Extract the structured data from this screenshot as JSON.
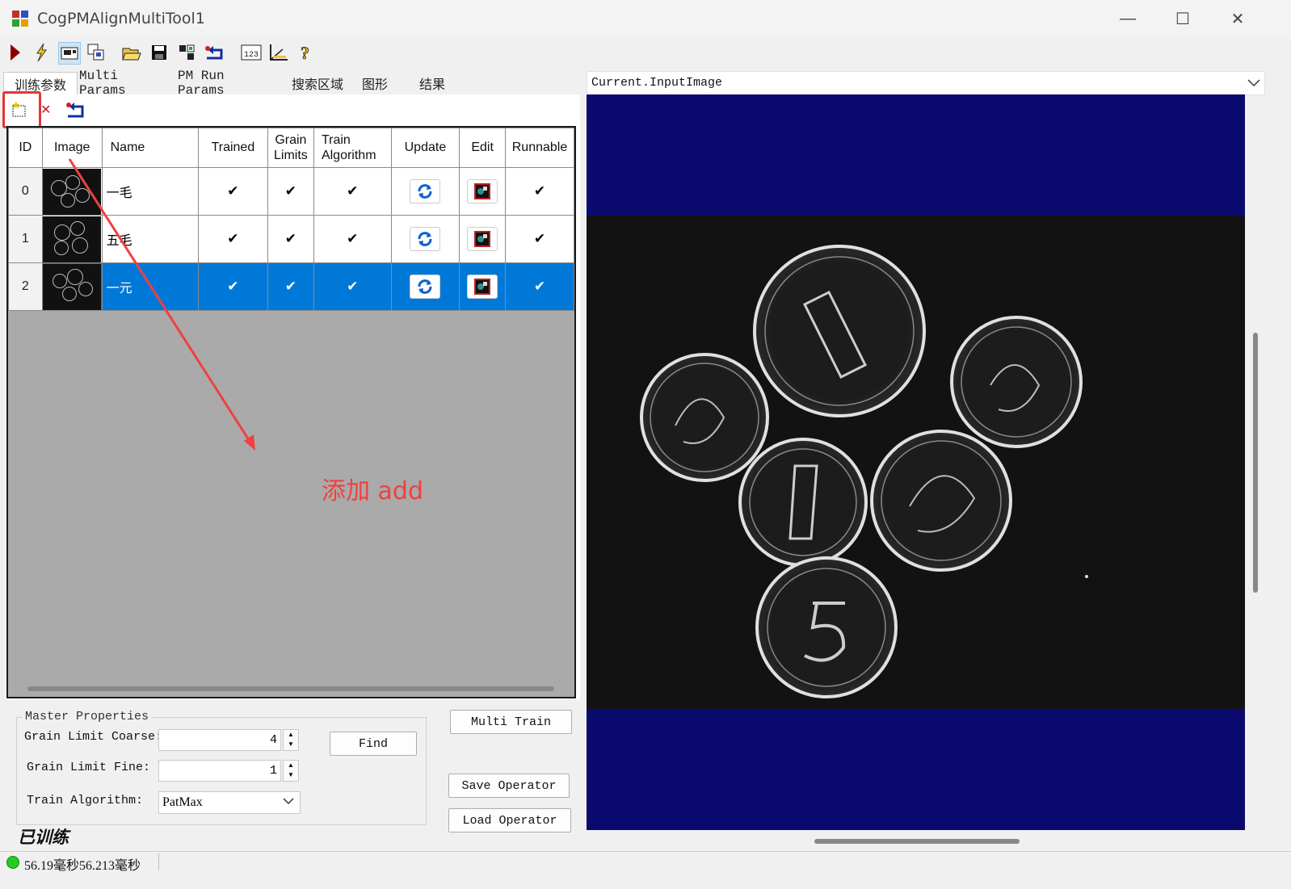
{
  "window": {
    "title": "CogPMAlignMultiTool1",
    "minimize": "—",
    "maximize": "☐",
    "close": "✕"
  },
  "toolbar": {
    "icons": [
      "run-icon",
      "live-icon",
      "image-display-icon",
      "copy-icon",
      "open-icon",
      "save-icon",
      "graphics-icon",
      "reset-icon",
      "numeric-display-icon",
      "measure-icon",
      "help-icon"
    ],
    "accent": "#0078d7"
  },
  "tabs": [
    "训练参数",
    "Multi Params",
    "PM Run Params",
    "搜索区域",
    "图形",
    "结果"
  ],
  "grid": {
    "columns": [
      "ID",
      "Image",
      "Name",
      "Trained",
      "Grain Limits",
      "Train Algorithm",
      "Update",
      "Edit",
      "Runnable"
    ],
    "rows": [
      {
        "id": "0",
        "name": "一毛",
        "trained": "✔",
        "grain": "✔",
        "algo": "✔",
        "runnable": "✔"
      },
      {
        "id": "1",
        "name": "五毛",
        "trained": "✔",
        "grain": "✔",
        "algo": "✔",
        "runnable": "✔"
      },
      {
        "id": "2",
        "name": "一元",
        "trained": "✔",
        "grain": "✔",
        "algo": "✔",
        "runnable": "✔"
      }
    ],
    "selected_row": 2
  },
  "annotation": {
    "text": "添加 add",
    "color": "#f04040"
  },
  "master": {
    "legend": "Master Properties",
    "coarse_label": "Grain Limit Coarse:",
    "coarse_value": "4",
    "fine_label": "Grain Limit Fine:",
    "fine_value": "1",
    "algo_label": "Train Algorithm:",
    "algo_value": "PatMax",
    "find": "Find",
    "multi_train": "Multi Train",
    "save_operator": "Save Operator",
    "load_operator": "Load Operator"
  },
  "trained_status": "已训练",
  "display": {
    "selector": "Current.InputImage",
    "background": "#0a0a6e"
  },
  "status": {
    "text": "56.19毫秒56.213毫秒"
  }
}
